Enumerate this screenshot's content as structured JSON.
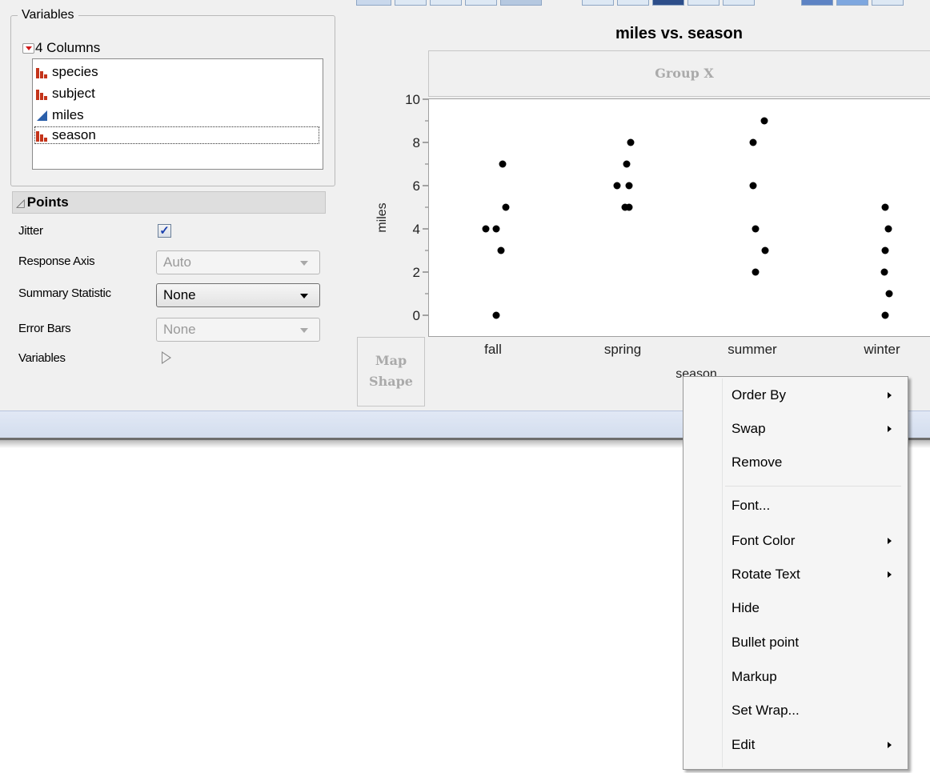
{
  "variables_panel": {
    "legend": "Variables",
    "columns_header": "4 Columns",
    "columns": [
      {
        "name": "species",
        "type": "nominal-icon"
      },
      {
        "name": "subject",
        "type": "nominal-icon"
      },
      {
        "name": "miles",
        "type": "continuous-icon"
      },
      {
        "name": "season",
        "type": "nominal-icon",
        "selected": true
      }
    ]
  },
  "points_panel": {
    "title": "Points",
    "jitter_label": "Jitter",
    "jitter_checked": true,
    "jitter_check_glyph": "✓",
    "response_axis_label": "Response Axis",
    "response_axis_value": "Auto",
    "summary_statistic_label": "Summary Statistic",
    "summary_statistic_value": "None",
    "error_bars_label": "Error Bars",
    "error_bars_value": "None",
    "variables_label": "Variables"
  },
  "graph": {
    "group_x_label": "Group X",
    "map_shape_line1": "Map",
    "map_shape_line2": "Shape"
  },
  "chart_data": {
    "type": "scatter",
    "title": "miles vs. season",
    "xlabel": "season",
    "ylabel": "miles",
    "categories": [
      "fall",
      "spring",
      "summer",
      "winter"
    ],
    "ylim": [
      -1,
      11
    ],
    "yticks": [
      0,
      2,
      4,
      6,
      8,
      10
    ],
    "points": [
      {
        "category": "fall",
        "y": 7,
        "jitter": 0.08
      },
      {
        "category": "fall",
        "y": 5,
        "jitter": 0.12
      },
      {
        "category": "fall",
        "y": 4,
        "jitter": -0.13
      },
      {
        "category": "fall",
        "y": 4,
        "jitter": 0.0
      },
      {
        "category": "fall",
        "y": 3,
        "jitter": 0.06
      },
      {
        "category": "fall",
        "y": 0,
        "jitter": 0.0
      },
      {
        "category": "spring",
        "y": 8,
        "jitter": 0.06
      },
      {
        "category": "spring",
        "y": 7,
        "jitter": 0.01
      },
      {
        "category": "spring",
        "y": 6,
        "jitter": -0.11
      },
      {
        "category": "spring",
        "y": 6,
        "jitter": 0.04
      },
      {
        "category": "spring",
        "y": 5,
        "jitter": -0.01
      },
      {
        "category": "spring",
        "y": 5,
        "jitter": 0.04
      },
      {
        "category": "summer",
        "y": 9,
        "jitter": 0.11
      },
      {
        "category": "summer",
        "y": 8,
        "jitter": -0.03
      },
      {
        "category": "summer",
        "y": 6,
        "jitter": -0.03
      },
      {
        "category": "summer",
        "y": 4,
        "jitter": 0.0
      },
      {
        "category": "summer",
        "y": 3,
        "jitter": 0.12
      },
      {
        "category": "summer",
        "y": 2,
        "jitter": 0.0
      },
      {
        "category": "winter",
        "y": 5,
        "jitter": 0.0
      },
      {
        "category": "winter",
        "y": 4,
        "jitter": 0.04
      },
      {
        "category": "winter",
        "y": 3,
        "jitter": 0.0
      },
      {
        "category": "winter",
        "y": 2,
        "jitter": -0.01
      },
      {
        "category": "winter",
        "y": 1,
        "jitter": 0.05
      },
      {
        "category": "winter",
        "y": 0,
        "jitter": 0.0
      }
    ],
    "point_color": "#000000",
    "grid": false,
    "legend": "none"
  },
  "context_menu": {
    "items": [
      {
        "label": "Order By",
        "submenu": true
      },
      {
        "label": "Swap",
        "submenu": true
      },
      {
        "label": "Remove",
        "submenu": false
      },
      {
        "label": "Font...",
        "submenu": false
      },
      {
        "label": "Font Color",
        "submenu": true
      },
      {
        "label": "Rotate Text",
        "submenu": true
      },
      {
        "label": "Hide",
        "submenu": false
      },
      {
        "label": "Bullet point",
        "submenu": false
      },
      {
        "label": "Markup",
        "submenu": false
      },
      {
        "label": "Set Wrap...",
        "submenu": false
      },
      {
        "label": "Edit",
        "submenu": true
      }
    ]
  },
  "colors": {
    "nominal_icon": "#c4341a",
    "continuous_icon": "#2b5faa",
    "separator_bar": "#d8e1f0"
  }
}
